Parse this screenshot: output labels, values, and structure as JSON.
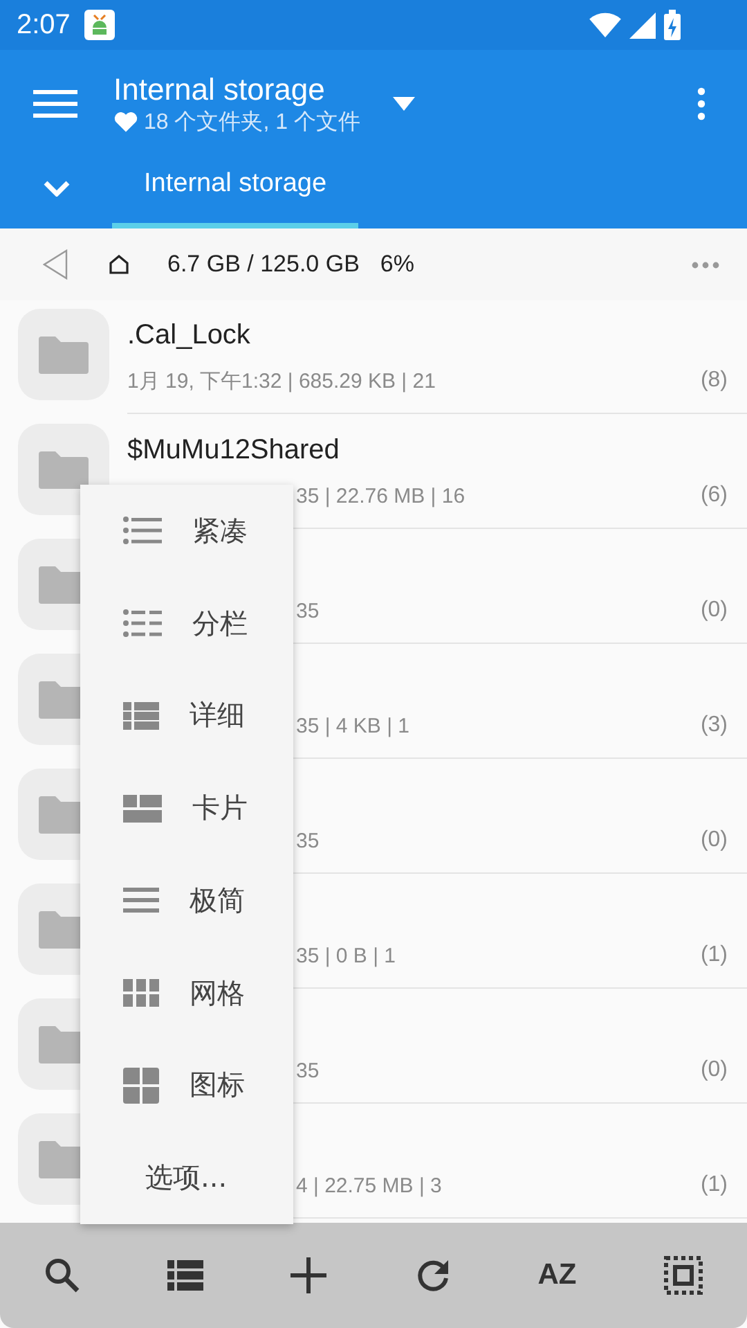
{
  "status_bar": {
    "time": "2:07"
  },
  "toolbar": {
    "title": "Internal storage",
    "subtitle": "18 个文件夹, 1 个文件"
  },
  "tabs": [
    {
      "label": "Internal storage",
      "selected": true
    }
  ],
  "path_bar": {
    "usage": "6.7 GB / 125.0 GB",
    "percent": "6%"
  },
  "files": [
    {
      "name": ".Cal_Lock",
      "meta": "1月 19, 下午1:32 | 685.29  KB | 21",
      "count": "(8)"
    },
    {
      "name": "$MuMu12Shared",
      "meta": "35 | 22.76 MB | 16",
      "count": "(6)"
    },
    {
      "meta": "35",
      "count": "(0)"
    },
    {
      "meta": "35 | 4  KB | 1",
      "count": "(3)"
    },
    {
      "meta": "35",
      "count": "(0)"
    },
    {
      "meta": "35 | 0 B | 1",
      "count": "(1)"
    },
    {
      "meta": "35",
      "count": "(0)"
    },
    {
      "meta": "4 | 22.75 MB | 3",
      "count": "(1)"
    }
  ],
  "view_menu": [
    {
      "kind": "compact",
      "label": "紧凑"
    },
    {
      "kind": "columns",
      "label": "分栏"
    },
    {
      "kind": "detailed",
      "label": "详细"
    },
    {
      "kind": "cards",
      "label": "卡片"
    },
    {
      "kind": "minimal",
      "label": "极简"
    },
    {
      "kind": "grid",
      "label": "网格"
    },
    {
      "kind": "icons",
      "label": "图标"
    },
    {
      "kind": "options",
      "label": "选项..."
    }
  ],
  "bottom_bar": [
    {
      "kind": "search"
    },
    {
      "kind": "list"
    },
    {
      "kind": "add"
    },
    {
      "kind": "refresh"
    },
    {
      "kind": "sort",
      "label": "AZ"
    },
    {
      "kind": "select"
    }
  ]
}
